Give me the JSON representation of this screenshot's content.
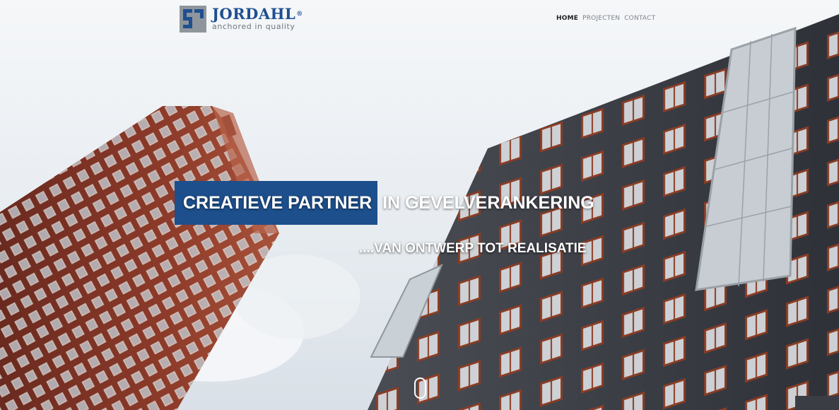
{
  "header": {
    "logo": {
      "name": "JORDAHL",
      "registered": "®",
      "tagline": "anchored in quality"
    },
    "nav": [
      {
        "label": "HOME",
        "active": true
      },
      {
        "label": "PROJECTEN",
        "active": false
      },
      {
        "label": "CONTACT",
        "active": false
      }
    ]
  },
  "hero": {
    "headline_highlight": "CREATIEVE PARTNER",
    "headline_rest": "IN GEVELVERANKERING",
    "subheadline": "....VAN ONTWERP TOT REALISATIE",
    "background_image": "two-high-rise-brick-buildings-against-sky",
    "scroll_icon": "mouse-scroll-icon"
  },
  "colors": {
    "brand_blue": "#1d4f8c",
    "logo_grey": "#8e959c",
    "nav_active": "#222222",
    "nav_inactive": "#7d858c"
  }
}
